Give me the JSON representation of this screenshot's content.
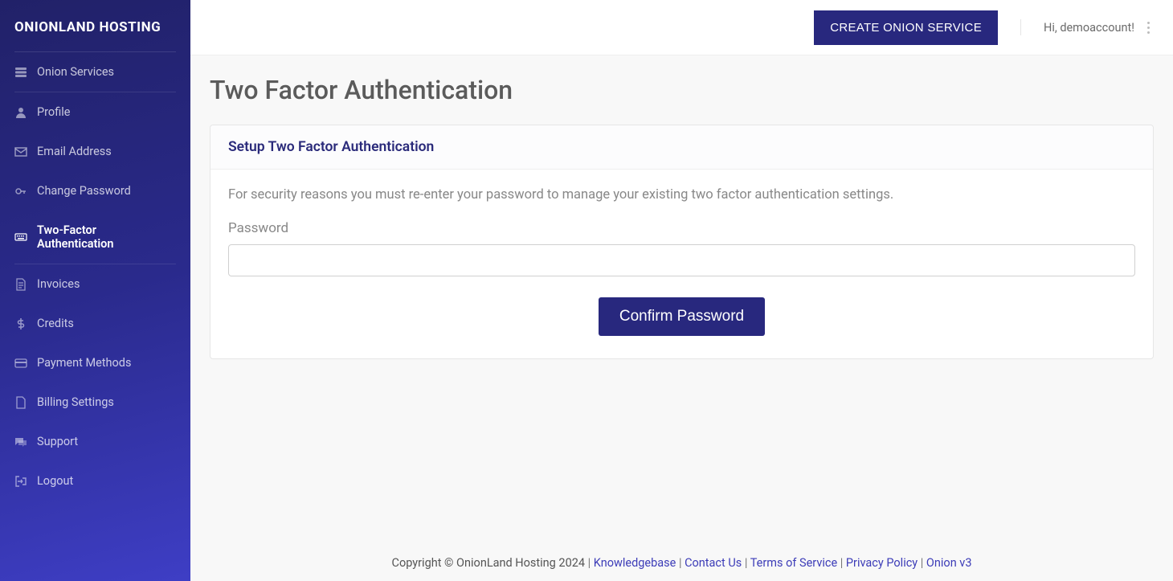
{
  "brand": "ONIONLAND HOSTING",
  "sidebar": {
    "items": [
      {
        "label": "Onion Services",
        "icon": "server-icon",
        "active": false
      },
      {
        "label": "Profile",
        "icon": "user-icon",
        "active": false
      },
      {
        "label": "Email Address",
        "icon": "envelope-icon",
        "active": false
      },
      {
        "label": "Change Password",
        "icon": "key-icon",
        "active": false
      },
      {
        "label": "Two-Factor Authentication",
        "icon": "keyboard-icon",
        "active": true
      },
      {
        "label": "Invoices",
        "icon": "file-invoice-icon",
        "active": false
      },
      {
        "label": "Credits",
        "icon": "dollar-icon",
        "active": false
      },
      {
        "label": "Payment Methods",
        "icon": "credit-card-icon",
        "active": false
      },
      {
        "label": "Billing Settings",
        "icon": "file-icon",
        "active": false
      },
      {
        "label": "Support",
        "icon": "comments-icon",
        "active": false
      },
      {
        "label": "Logout",
        "icon": "logout-icon",
        "active": false
      }
    ]
  },
  "header": {
    "create_button": "CREATE ONION SERVICE",
    "greeting": "Hi, demoaccount!"
  },
  "main": {
    "title": "Two Factor Authentication",
    "card_title": "Setup Two Factor Authentication",
    "info": "For security reasons you must re-enter your password to manage your existing two factor authentication settings.",
    "password_label": "Password",
    "confirm_button": "Confirm Password"
  },
  "footer": {
    "copyright": "Copyright © OnionLand Hosting 2024",
    "links": [
      "Knowledgebase",
      "Contact Us",
      "Terms of Service",
      "Privacy Policy",
      "Onion v3"
    ]
  }
}
